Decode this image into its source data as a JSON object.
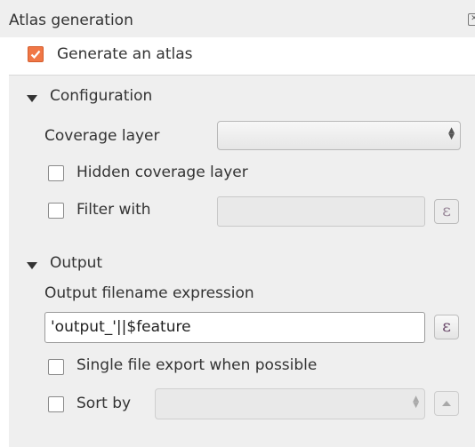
{
  "dock": {
    "title": "Atlas generation",
    "close_icon": "close-icon"
  },
  "generate": {
    "label": "Generate an atlas",
    "checked": true
  },
  "configuration": {
    "header": "Configuration",
    "coverage_layer_label": "Coverage layer",
    "coverage_layer_value": "",
    "hidden_coverage_label": "Hidden coverage layer",
    "filter_with_label": "Filter with",
    "filter_value": ""
  },
  "output": {
    "header": "Output",
    "filename_label": "Output filename expression",
    "filename_value": "'output_'||$feature",
    "single_file_label": "Single file export when possible",
    "sort_by_label": "Sort by",
    "sort_by_value": ""
  },
  "expression_button_glyph": "ε",
  "colors": {
    "accent": "#f07746",
    "panel": "#efefef"
  }
}
